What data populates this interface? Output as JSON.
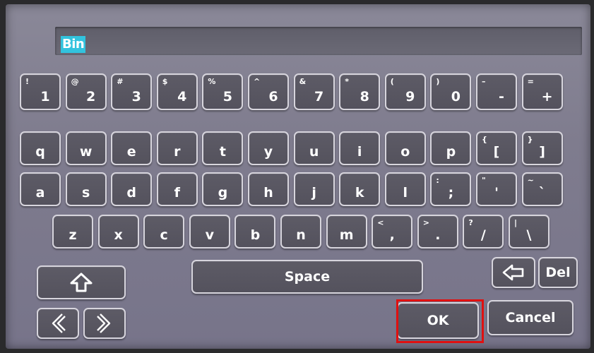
{
  "input": {
    "value": "Bin"
  },
  "rows": {
    "numbers": [
      {
        "main": "1",
        "shift": "!"
      },
      {
        "main": "2",
        "shift": "@"
      },
      {
        "main": "3",
        "shift": "#"
      },
      {
        "main": "4",
        "shift": "$"
      },
      {
        "main": "5",
        "shift": "%"
      },
      {
        "main": "6",
        "shift": "^"
      },
      {
        "main": "7",
        "shift": "&"
      },
      {
        "main": "8",
        "shift": "*"
      },
      {
        "main": "9",
        "shift": "("
      },
      {
        "main": "0",
        "shift": ")"
      },
      {
        "main": "-",
        "shift": "–"
      },
      {
        "main": "+",
        "shift": "="
      }
    ],
    "top": [
      {
        "main": "q",
        "shift": ""
      },
      {
        "main": "w",
        "shift": ""
      },
      {
        "main": "e",
        "shift": ""
      },
      {
        "main": "r",
        "shift": ""
      },
      {
        "main": "t",
        "shift": ""
      },
      {
        "main": "y",
        "shift": ""
      },
      {
        "main": "u",
        "shift": ""
      },
      {
        "main": "i",
        "shift": ""
      },
      {
        "main": "o",
        "shift": ""
      },
      {
        "main": "p",
        "shift": ""
      },
      {
        "main": "[",
        "shift": "{"
      },
      {
        "main": "]",
        "shift": "}"
      }
    ],
    "home": [
      {
        "main": "a",
        "shift": ""
      },
      {
        "main": "s",
        "shift": ""
      },
      {
        "main": "d",
        "shift": ""
      },
      {
        "main": "f",
        "shift": ""
      },
      {
        "main": "g",
        "shift": ""
      },
      {
        "main": "h",
        "shift": ""
      },
      {
        "main": "j",
        "shift": ""
      },
      {
        "main": "k",
        "shift": ""
      },
      {
        "main": "l",
        "shift": ""
      },
      {
        "main": ";",
        "shift": ":"
      },
      {
        "main": "'",
        "shift": "\""
      },
      {
        "main": "`",
        "shift": "~"
      }
    ],
    "bottom": [
      {
        "main": "z",
        "shift": ""
      },
      {
        "main": "x",
        "shift": ""
      },
      {
        "main": "c",
        "shift": ""
      },
      {
        "main": "v",
        "shift": ""
      },
      {
        "main": "b",
        "shift": ""
      },
      {
        "main": "n",
        "shift": ""
      },
      {
        "main": "m",
        "shift": ""
      },
      {
        "main": ",",
        "shift": "<"
      },
      {
        "main": ".",
        "shift": ">"
      },
      {
        "main": "/",
        "shift": "?"
      },
      {
        "main": "\\",
        "shift": "|"
      }
    ]
  },
  "controls": {
    "space_label": "Space",
    "delete_label": "Del",
    "ok_label": "OK",
    "cancel_label": "Cancel",
    "shift_icon": "shift-arrow-icon",
    "backspace_icon": "backspace-arrow-icon",
    "left_icon": "chevron-left-icon",
    "right_icon": "chevron-right-icon"
  },
  "colors": {
    "input_highlight": "#32c3de",
    "selection_box": "#e01010"
  }
}
